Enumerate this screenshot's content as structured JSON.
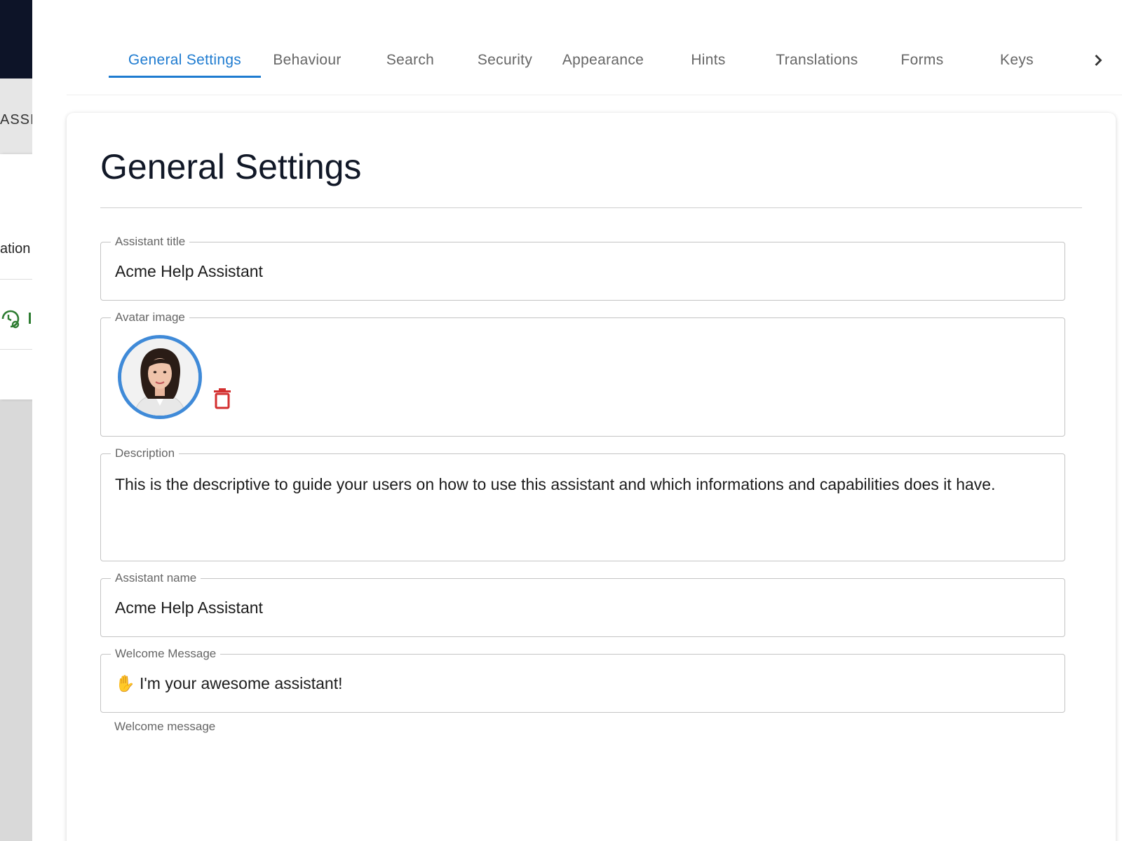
{
  "sidebar": {
    "partial_label_top": "ASSI",
    "partial_label_mid": "ation"
  },
  "tabs": [
    {
      "label": "General Settings",
      "active": true
    },
    {
      "label": "Behaviour"
    },
    {
      "label": "Search"
    },
    {
      "label": "Security"
    },
    {
      "label": "Appearance"
    },
    {
      "label": "Hints"
    },
    {
      "label": "Translations"
    },
    {
      "label": "Forms"
    },
    {
      "label": "Keys"
    }
  ],
  "page": {
    "title": "General Settings"
  },
  "fields": {
    "assistant_title": {
      "label": "Assistant title",
      "value": "Acme Help Assistant"
    },
    "avatar": {
      "label": "Avatar image"
    },
    "description": {
      "label": "Description",
      "value": "This is the descriptive to guide your users on how to use this assistant and which informations and capabilities does it have."
    },
    "assistant_name": {
      "label": "Assistant name",
      "value": "Acme Help Assistant"
    },
    "welcome_message": {
      "label": "Welcome Message",
      "value": "✋ I'm your awesome assistant!",
      "helper": "Welcome message"
    }
  },
  "colors": {
    "accent": "#1e7bd0",
    "danger": "#d32f2f",
    "sidebar_dark": "#0d1428",
    "avatar_ring": "#3f8ad8"
  },
  "icons": {
    "next": "chevron-right-icon",
    "delete": "trash-icon",
    "sidebar": "clock-settings-icon"
  }
}
